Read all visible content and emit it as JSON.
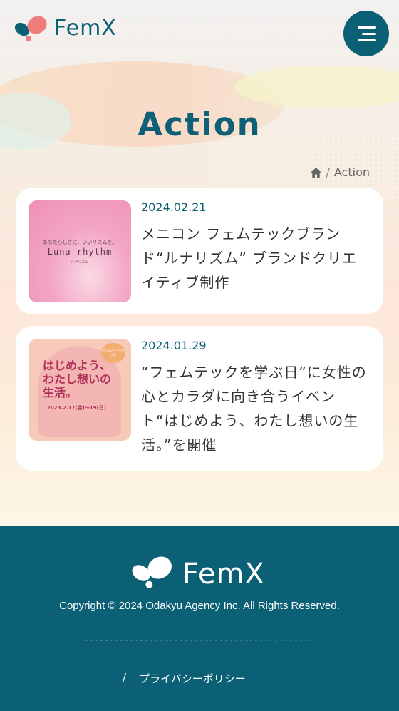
{
  "header": {
    "logo_text": "FemX",
    "menu_icon": "hamburger-icon"
  },
  "page": {
    "title": "Action"
  },
  "breadcrumb": {
    "home_icon": "home-icon",
    "separator": "/",
    "current": "Action"
  },
  "articles": [
    {
      "date": "2024.02.21",
      "title": "メニコン フェムテックブランド“ルナリズム” ブランドクリエイティブ制作",
      "thumb_small": "あなたらしさに、いいリズムを。",
      "thumb_big": "Luna rhythm",
      "thumb_tiny": "ルナリズム"
    },
    {
      "date": "2024.01.29",
      "title": "“フェムテックを学ぶ日”に女性の心とカラダに向き合うイベント“はじめよう、わたし想いの生活。”を開催",
      "thumb_title": "はじめよう、わたし想いの生活。",
      "thumb_date": "2023.2.17(金)〜19(日)",
      "thumb_badge": "フェムテックを学ぶ日"
    }
  ],
  "footer": {
    "logo_text": "FemX",
    "copyright_prefix": "Copyright © 2024 ",
    "company_link": "Odakyu Agency Inc.",
    "copyright_suffix": " All Rights Reserved.",
    "link_separator": "/",
    "privacy_link": "プライバシーポリシー"
  },
  "colors": {
    "brand_teal": "#0c6076",
    "logo_coral": "#ef7b7b"
  }
}
